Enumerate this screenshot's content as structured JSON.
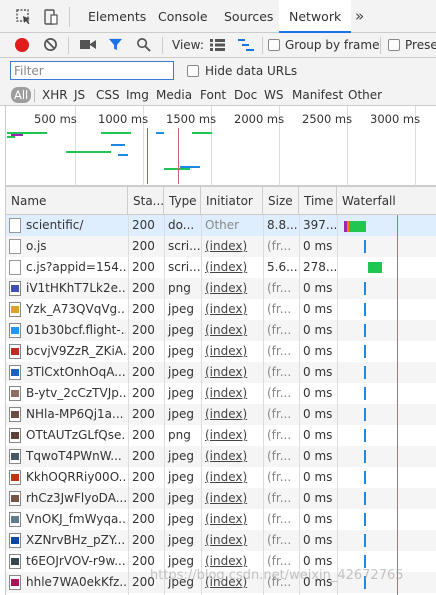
{
  "tabbar": {
    "tabs": [
      "Elements",
      "Console",
      "Sources",
      "Network"
    ],
    "active_tab": "Network",
    "more_label": "»"
  },
  "toolbar": {
    "view_label": "View:",
    "group_by_frame": "Group by frame",
    "preserve_log": "Prese"
  },
  "filter": {
    "placeholder": "Filter",
    "hide_data_urls": "Hide data URLs"
  },
  "type_filters": [
    "All",
    "XHR",
    "JS",
    "CSS",
    "Img",
    "Media",
    "Font",
    "Doc",
    "WS",
    "Manifest",
    "Other"
  ],
  "overview": {
    "ticks": [
      "500 ms",
      "1000 ms",
      "1500 ms",
      "2000 ms",
      "2500 ms",
      "3000 ms"
    ]
  },
  "table": {
    "columns": [
      "Name",
      "Sta...",
      "Type",
      "Initiator",
      "Size",
      "Time",
      "Waterfall"
    ],
    "rows": [
      {
        "name": "scientific/",
        "status": "200",
        "type": "do...",
        "initiator": "Other",
        "size": "8.8...",
        "time": "397...",
        "icon": "document-icon"
      },
      {
        "name": "o.js",
        "status": "200",
        "type": "scri...",
        "initiator": "(index)",
        "size": "(fr...",
        "time": "0 ms",
        "icon": "document-icon"
      },
      {
        "name": "c.js?appid=154...",
        "status": "200",
        "type": "scri...",
        "initiator": "(index)",
        "size": "5.6...",
        "time": "278...",
        "icon": "document-icon"
      },
      {
        "name": "iV1tHKhT7Lk2e...",
        "status": "200",
        "type": "png",
        "initiator": "(index)",
        "size": "(fr...",
        "time": "0 ms",
        "icon": "image-icon"
      },
      {
        "name": "Yzk_A73QVqVg...",
        "status": "200",
        "type": "jpeg",
        "initiator": "(index)",
        "size": "(fr...",
        "time": "0 ms",
        "icon": "image-icon"
      },
      {
        "name": "01b30bcf.flight-...",
        "status": "200",
        "type": "jpeg",
        "initiator": "(index)",
        "size": "(fr...",
        "time": "0 ms",
        "icon": "image-icon"
      },
      {
        "name": "bcvjV9ZzR_ZKiA...",
        "status": "200",
        "type": "jpeg",
        "initiator": "(index)",
        "size": "(fr...",
        "time": "0 ms",
        "icon": "image-icon"
      },
      {
        "name": "3TlCxtOnhOqA...",
        "status": "200",
        "type": "jpeg",
        "initiator": "(index)",
        "size": "(fr...",
        "time": "0 ms",
        "icon": "image-icon"
      },
      {
        "name": "B-ytv_2cCzTVJp...",
        "status": "200",
        "type": "jpeg",
        "initiator": "(index)",
        "size": "(fr...",
        "time": "0 ms",
        "icon": "image-icon"
      },
      {
        "name": "NHla-MP6Qj1a...",
        "status": "200",
        "type": "jpeg",
        "initiator": "(index)",
        "size": "(fr...",
        "time": "0 ms",
        "icon": "image-icon"
      },
      {
        "name": "OTtAUTzGLfQse...",
        "status": "200",
        "type": "png",
        "initiator": "(index)",
        "size": "(fr...",
        "time": "0 ms",
        "icon": "image-icon"
      },
      {
        "name": "TqwoT4PWnW...",
        "status": "200",
        "type": "jpeg",
        "initiator": "(index)",
        "size": "(fr...",
        "time": "0 ms",
        "icon": "image-icon"
      },
      {
        "name": "KkhOQRRiy00O...",
        "status": "200",
        "type": "jpeg",
        "initiator": "(index)",
        "size": "(fr...",
        "time": "0 ms",
        "icon": "image-icon"
      },
      {
        "name": "rhCz3JwFlyoDA...",
        "status": "200",
        "type": "jpeg",
        "initiator": "(index)",
        "size": "(fr...",
        "time": "0 ms",
        "icon": "image-icon"
      },
      {
        "name": "VnOKJ_fmWyqa...",
        "status": "200",
        "type": "jpeg",
        "initiator": "(index)",
        "size": "(fr...",
        "time": "0 ms",
        "icon": "image-icon"
      },
      {
        "name": "XZNrvBHz_pZY...",
        "status": "200",
        "type": "jpeg",
        "initiator": "(index)",
        "size": "(fr...",
        "time": "0 ms",
        "icon": "image-icon"
      },
      {
        "name": "t6EOJrVOV-r9w...",
        "status": "200",
        "type": "jpeg",
        "initiator": "(index)",
        "size": "(fr...",
        "time": "0 ms",
        "icon": "image-icon"
      },
      {
        "name": "hhle7WA0ekKfz...",
        "status": "200",
        "type": "jpeg",
        "initiator": "(index)",
        "size": "(fr...",
        "time": "0 ms",
        "icon": "image-icon"
      }
    ]
  },
  "watermark": "https://blog.csdn.net/weixin_42672765",
  "colors": {
    "accent": "#1a73e8",
    "record": "#e21b1b",
    "waterfall_green": "#1fc651",
    "waterfall_blue": "#1e88e5",
    "load_line": "#d2607a"
  }
}
